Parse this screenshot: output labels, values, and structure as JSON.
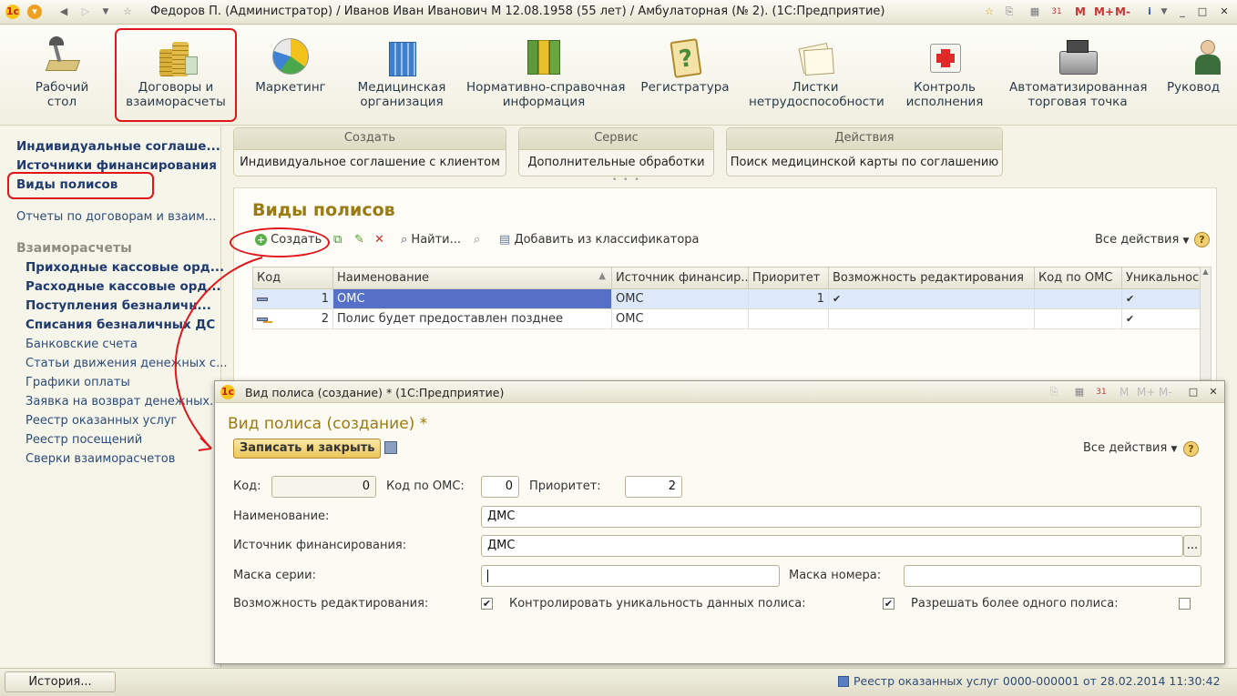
{
  "window": {
    "title": "Федоров П. (Администратор) / Иванов Иван Иванович М 12.08.1958 (55 лет) / Амбулаторная (№ 2).  (1С:Предприятие)",
    "memo_buttons": [
      "M",
      "M+",
      "M-"
    ]
  },
  "sections": [
    {
      "label": "Рабочий\nстол",
      "icon": "desk-lamp-icon"
    },
    {
      "label": "Договоры и\nвзаиморасчеты",
      "icon": "coins-icon"
    },
    {
      "label": "Маркетинг",
      "icon": "pie-chart-icon"
    },
    {
      "label": "Медицинская\nорганизация",
      "icon": "building-icon"
    },
    {
      "label": "Нормативно-справочная\nинформация",
      "icon": "folders-icon"
    },
    {
      "label": "Регистратура",
      "icon": "clipboard-question-icon"
    },
    {
      "label": "Листки\nнетрудоспособности",
      "icon": "documents-icon"
    },
    {
      "label": "Контроль\nисполнения",
      "icon": "first-aid-icon"
    },
    {
      "label": "Автоматизированная\nторговая точка",
      "icon": "cash-register-icon"
    },
    {
      "label": "Руковод",
      "icon": "manager-icon"
    }
  ],
  "left_nav": {
    "items_top": [
      "Индивидуальные соглаше...",
      "Источники финансирования",
      "Виды полисов"
    ],
    "reports": "Отчеты по договорам и взаим...",
    "group_title": "Взаиморасчеты",
    "group_items_bold": [
      "Приходные кассовые орд...",
      "Расходные кассовые орд...",
      "Поступления безналичн...",
      "Списания безналичных ДС"
    ],
    "group_items": [
      "Банковские счета",
      "Статьи движения денежных с...",
      "Графики оплаты",
      "Заявка на возврат денежных...",
      "Реестр оказанных услуг",
      "Реестр посещений",
      "Сверки взаиморасчетов"
    ]
  },
  "command_panels": [
    {
      "header": "Создать",
      "command": "Индивидуальное соглашение с клиентом"
    },
    {
      "header": "Сервис",
      "command": "Дополнительные обработки"
    },
    {
      "header": "Действия",
      "command": "Поиск медицинской карты по соглашению"
    }
  ],
  "list_form": {
    "title": "Виды полисов",
    "toolbar": {
      "create": "Создать",
      "find": "Найти...",
      "add_from_classifier": "Добавить из классификатора",
      "all_actions": "Все действия",
      "help": "?"
    },
    "columns": [
      "Код",
      "Наименование",
      "Источник финансир...",
      "Приоритет",
      "Возможность редактирования",
      "Код по ОМС",
      "Уникальнос"
    ],
    "rows": [
      {
        "code": "1",
        "name": "ОМС",
        "source": "ОМС",
        "priority": "1",
        "editable": "✔",
        "oms_code": "",
        "unique": "✔"
      },
      {
        "code": "2",
        "name": "Полис будет предоставлен позднее",
        "source": "ОМС",
        "priority": "",
        "editable": "",
        "oms_code": "",
        "unique": "✔"
      }
    ]
  },
  "dialog": {
    "window_title": "Вид полиса (создание) * (1С:Предприятие)",
    "form_title": "Вид полиса (создание) *",
    "save_close": "Записать и закрыть",
    "all_actions": "Все действия",
    "help": "?",
    "memo_buttons": [
      "M",
      "M+",
      "M-"
    ],
    "fields": {
      "code_label": "Код:",
      "code_value": "0",
      "oms_label": "Код по ОМС:",
      "oms_value": "0",
      "priority_label": "Приоритет:",
      "priority_value": "2",
      "name_label": "Наименование:",
      "name_value": "ДМС",
      "source_label": "Источник финансирования:",
      "source_value": "ДМС",
      "source_button": "...",
      "series_mask_label": "Маска серии:",
      "series_mask_value": "",
      "number_mask_label": "Маска номера:",
      "number_mask_value": "",
      "editable_label": "Возможность редактирования:",
      "editable_checked": true,
      "unique_label": "Контролировать уникальность данных полиса:",
      "unique_checked": true,
      "multi_label": "Разрешать более одного полиса:",
      "multi_checked": false
    }
  },
  "status_bar": {
    "history_button": "История...",
    "message": "Реестр оказанных услуг 0000-000001 от 28.02.2014 11:30:42"
  },
  "colors": {
    "highlight_red": "#e0161b",
    "title_gold": "#9b7a14",
    "selection_blue": "#5570c6",
    "link_blue": "#1f3a6e"
  }
}
